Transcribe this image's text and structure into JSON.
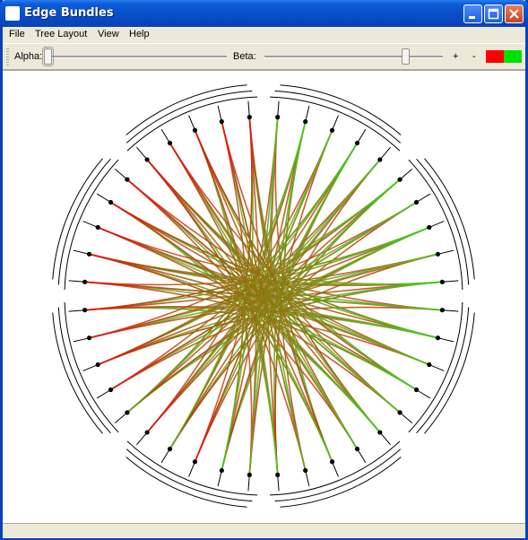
{
  "window": {
    "title": "Edge Bundles"
  },
  "menubar": {
    "items": [
      "File",
      "Tree Layout",
      "View",
      "Help"
    ]
  },
  "toolbar": {
    "alpha_label": "Alpha:",
    "beta_label": "Beta:",
    "alpha_value": 0.0,
    "beta_value": 0.8,
    "zoom_in": "+",
    "zoom_out": "-",
    "colors": {
      "start": "#FF0000",
      "end": "#00E000"
    }
  },
  "graph": {
    "node_count": 40,
    "edge_colors": {
      "from": "#E81010",
      "to": "#40D020"
    }
  }
}
